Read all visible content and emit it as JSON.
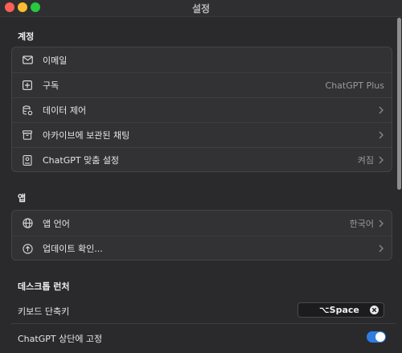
{
  "window": {
    "title": "설정"
  },
  "sections": {
    "account": {
      "header": "계정",
      "rows": [
        {
          "icon": "envelope-icon",
          "label": "이메일",
          "value": ""
        },
        {
          "icon": "plus-square-icon",
          "label": "구독",
          "value": "ChatGPT Plus"
        },
        {
          "icon": "database-settings-icon",
          "label": "데이터 제어",
          "value": ""
        },
        {
          "icon": "archive-box-icon",
          "label": "아카이브에 보관된 채팅",
          "value": ""
        },
        {
          "icon": "id-badge-icon",
          "label": "ChatGPT 맞춤 설정",
          "value": "켜짐"
        }
      ]
    },
    "app": {
      "header": "앱",
      "rows": [
        {
          "icon": "globe-icon",
          "label": "앱 언어",
          "value": "한국어"
        },
        {
          "icon": "arrow-up-circle-icon",
          "label": "업데이트 확인...",
          "value": ""
        }
      ]
    },
    "launcher": {
      "header": "데스크톱 런처",
      "shortcut_label": "키보드 단축키",
      "shortcut_value": "⌥Space",
      "pin_label": "ChatGPT 상단에 고정",
      "pin_enabled": true
    }
  },
  "colors": {
    "background": "#2a2a2c",
    "group_background": "#323234",
    "toggle_on": "#2f7de1",
    "secondary_text": "#9a9a9e"
  }
}
